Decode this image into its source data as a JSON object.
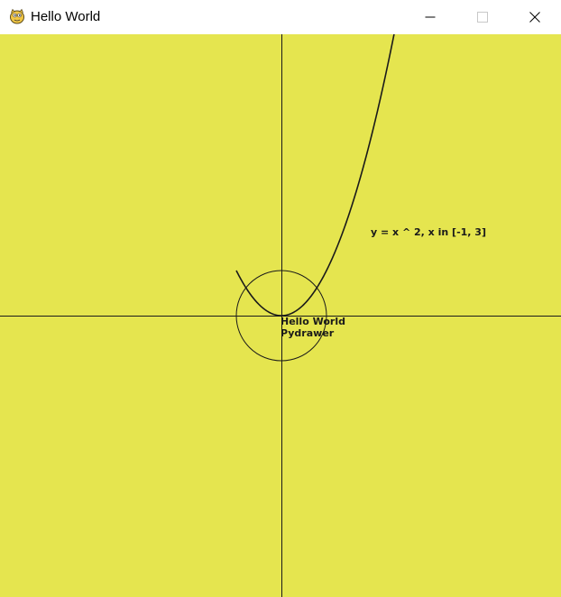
{
  "window": {
    "title": "Hello World",
    "controls": {
      "minimize_icon": "minimize-icon",
      "maximize_icon": "maximize-icon",
      "close_icon": "close-icon"
    },
    "app_icon": "python-icon"
  },
  "colors": {
    "canvas_background": "#e5e54f",
    "ink": "#1a1a1a",
    "titlebar": "#ffffff"
  },
  "canvas": {
    "equation_label": "y = x ^ 2, x in [-1, 3]",
    "origin_label_line1": "Hello World",
    "origin_label_line2": "Pydrawer"
  }
}
